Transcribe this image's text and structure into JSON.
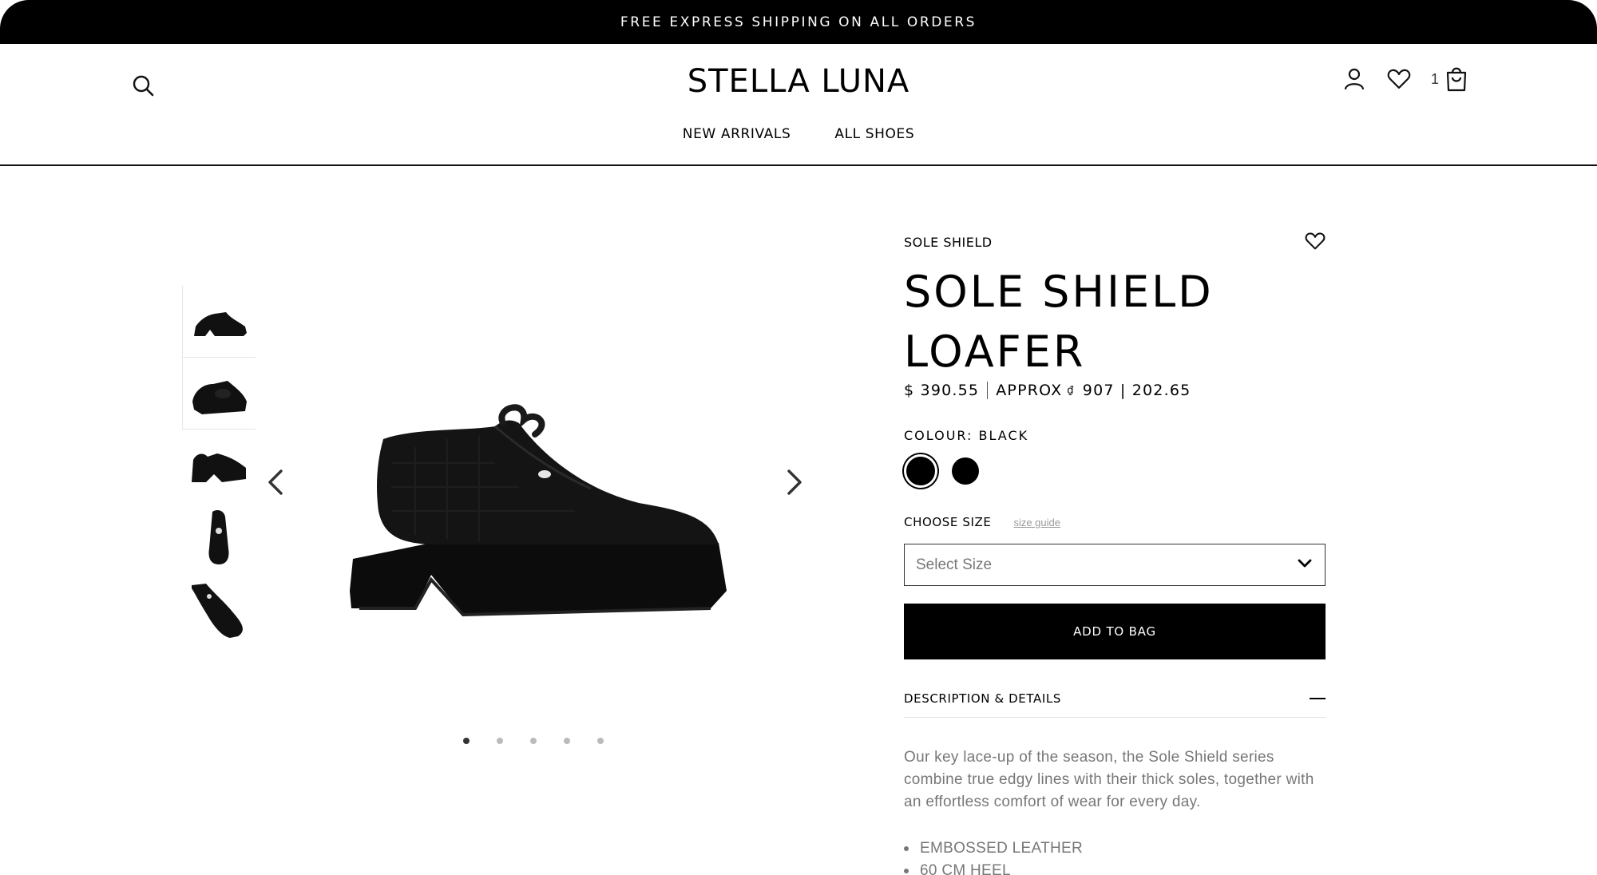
{
  "promo": {
    "text": "FREE EXPRESS SHIPPING ON ALL ORDERS"
  },
  "header": {
    "logo": "STELLA LUNA",
    "nav": [
      "NEW ARRIVALS",
      "ALL SHOES"
    ],
    "cart_count": "1",
    "icons": [
      "search-icon",
      "account-icon",
      "heart-icon",
      "shopping-bag-icon"
    ]
  },
  "gallery": {
    "thumbnails": 5,
    "active_slide": 1,
    "slides": 5
  },
  "product": {
    "brand": "SOLE SHIELD",
    "title_line1": "SOLE SHIELD",
    "title_line2": "LOAFER",
    "price": "$ 390.55",
    "approx_label": "APPROX",
    "approx_currency": "₫",
    "approx_value": "907 | 202.65",
    "colour_label": "COLOUR: BLACK",
    "swatches": [
      "#000000",
      "#000000"
    ],
    "size_label": "CHOOSE SIZE",
    "size_guide": "size guide",
    "size_placeholder": "Select Size",
    "add_to_bag": "ADD TO BAG",
    "desc_title": "DESCRIPTION & DETAILS",
    "description": "Our key lace-up of the season, the Sole Shield series combine true edgy lines with their thick soles, together with an effortless comfort of wear for every day.",
    "bullets": [
      "EMBOSSED LEATHER",
      "60 CM HEEL"
    ]
  },
  "colors": {
    "accent": "#000000",
    "muted_text": "#777777"
  }
}
